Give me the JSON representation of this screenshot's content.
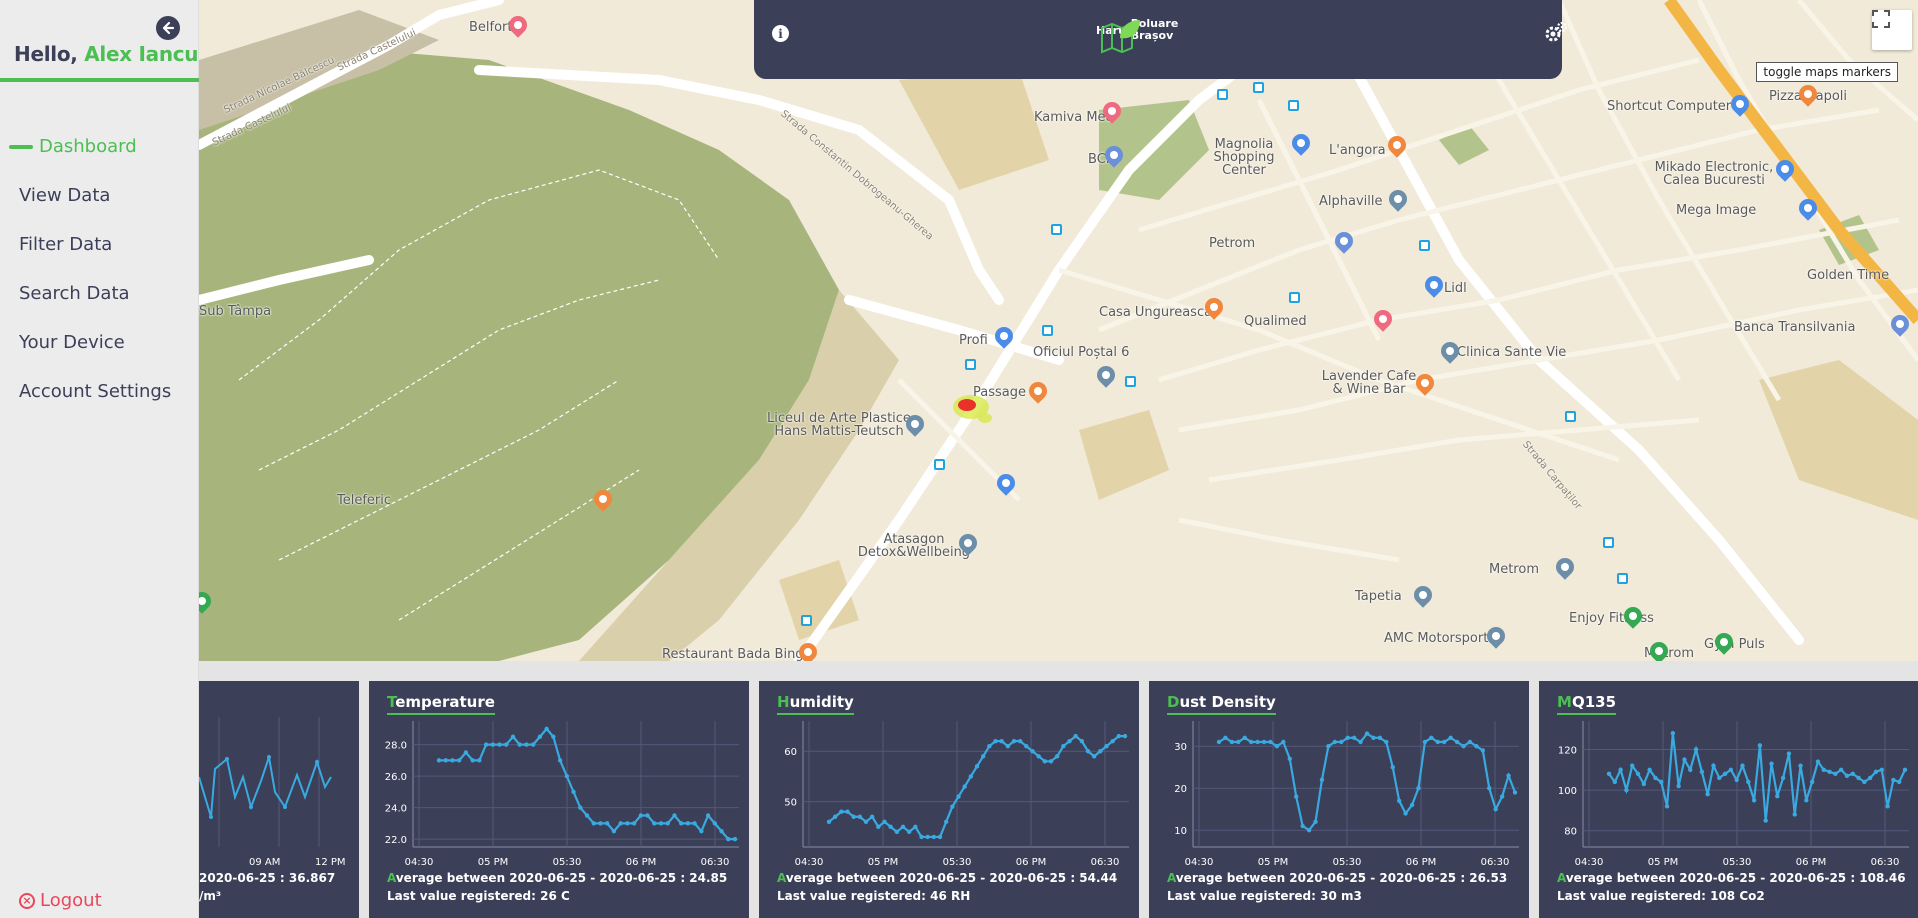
{
  "sidebar": {
    "greeting_prefix": "Hello, ",
    "user_name": "Alex Iancu",
    "items": [
      {
        "label": "Dashboard",
        "active": true
      },
      {
        "label": "View Data"
      },
      {
        "label": "Filter Data"
      },
      {
        "label": "Search Data"
      },
      {
        "label": "Your Device"
      },
      {
        "label": "Account Settings"
      }
    ],
    "logout_label": "Logout"
  },
  "topbar": {
    "logo_line1": "Harta",
    "logo_line2a": "Poluare",
    "logo_line2b": "Brașov"
  },
  "map": {
    "toggle_markers_label": "toggle maps markers",
    "labels": [
      "Belfort",
      "Strada Nicolae Bălcescu",
      "Strada Castelului",
      "Strada Castelului",
      "Strada Constantin Dobrogeanu-Gherea",
      "Kamiva Med",
      "BCR",
      "Magnolia Shopping Center",
      "L'angora",
      "Alphaville",
      "Petrom",
      "Lidl",
      "Casa Ungurească",
      "Qualimed",
      "Profi",
      "Oficiul Poștal 6",
      "Passage",
      "Lavender Cafe & Wine Bar",
      "Clinica Sante Vie",
      "Liceul de Arte Plastice Hans Mattis-Teutsch",
      "Atasagon Detox&Wellbeing",
      "Metrom",
      "Tapetia",
      "Enjoy Fitness",
      "AMC Motorsport",
      "Gym Puls",
      "Metrom",
      "Shortcut Computer",
      "Pizza Napoli",
      "Mikado Electronic, Calea Bucuresti",
      "Mega Image",
      "Golden Time",
      "Banca Transilvania",
      "Sub Tâmpa",
      "Teleferic",
      "Restaurant Bada Bing",
      "Strada Carpaților"
    ],
    "accent_color": "#4bbf52"
  },
  "cards": [
    {
      "title_first": "",
      "title_rest": "",
      "avg_first": "",
      "avg_rest": "2020-06-25 : 36.867",
      "last": "/m³",
      "x_ticks": [
        "09 AM",
        "12 PM"
      ]
    },
    {
      "title_first": "T",
      "title_rest": "emperature",
      "avg_first": "A",
      "avg_rest": "verage between 2020-06-25 - 2020-06-25 : 24.85",
      "last": "Last value registered: 26 C",
      "x_ticks": [
        "04:30",
        "05 PM",
        "05:30",
        "06 PM",
        "06:30"
      ],
      "y_ticks": [
        "28.0",
        "26.0",
        "24.0",
        "22.0"
      ]
    },
    {
      "title_first": "H",
      "title_rest": "umidity",
      "avg_first": "A",
      "avg_rest": "verage between 2020-06-25 - 2020-06-25 : 54.44",
      "last": "Last value registered: 46 RH",
      "x_ticks": [
        "04:30",
        "05 PM",
        "05:30",
        "06 PM",
        "06:30"
      ],
      "y_ticks": [
        "60",
        "50"
      ]
    },
    {
      "title_first": "D",
      "title_rest": "ust Density",
      "avg_first": "A",
      "avg_rest": "verage between 2020-06-25 - 2020-06-25 : 26.53",
      "last": "Last value registered: 30 m3",
      "x_ticks": [
        "04:30",
        "05 PM",
        "05:30",
        "06 PM",
        "06:30"
      ],
      "y_ticks": [
        "30",
        "20",
        "10"
      ]
    },
    {
      "title_first": "M",
      "title_rest": "Q135",
      "avg_first": "A",
      "avg_rest": "verage between 2020-06-25 - 2020-06-25 : 108.46",
      "last": "Last value registered: 108 Co2",
      "x_ticks": [
        "04:30",
        "05 PM",
        "05:30",
        "06 PM",
        "06:30"
      ],
      "y_ticks": [
        "120",
        "100",
        "80"
      ]
    }
  ],
  "chart_data": [
    {
      "type": "line",
      "title": "Temperature",
      "y_ticks": [
        28,
        26,
        24,
        22
      ],
      "ylim": [
        21.5,
        29.5
      ],
      "values": [
        27,
        27,
        27,
        27,
        27.5,
        27,
        27,
        28,
        28,
        28,
        28,
        28.5,
        28,
        28,
        28,
        28.5,
        29,
        28.5,
        27,
        26,
        25,
        24,
        23.5,
        23,
        23,
        23,
        22.5,
        23,
        23,
        23,
        23.5,
        23.5,
        23,
        23,
        23,
        23.5,
        23,
        23,
        23,
        22.5,
        23.5,
        23,
        22.5,
        22,
        22
      ]
    },
    {
      "type": "line",
      "title": "Humidity",
      "y_ticks": [
        60,
        50
      ],
      "ylim": [
        41,
        66
      ],
      "values": [
        46,
        47,
        48,
        48,
        47,
        47,
        46,
        47,
        45,
        46,
        45,
        44,
        45,
        44,
        45,
        43,
        43,
        43,
        43,
        46,
        49,
        51,
        53,
        55,
        57,
        59,
        61,
        62,
        62,
        61,
        62,
        62,
        61,
        60,
        59,
        58,
        58,
        59,
        61,
        62,
        63,
        62,
        60,
        59,
        60,
        61,
        62,
        63,
        63
      ]
    },
    {
      "type": "line",
      "title": "Dust Density",
      "y_ticks": [
        30,
        20,
        10
      ],
      "ylim": [
        6,
        36
      ],
      "values": [
        31,
        32,
        31,
        31,
        32,
        31,
        31,
        31,
        31,
        30,
        31,
        27,
        18,
        11,
        10,
        12,
        22,
        30,
        31,
        31,
        32,
        32,
        31,
        33,
        32,
        32,
        31,
        25,
        17,
        14,
        16,
        20,
        31,
        32,
        31,
        31,
        32,
        31,
        30,
        31,
        30,
        29,
        20,
        15,
        18,
        23,
        19
      ]
    },
    {
      "type": "line",
      "title": "MQ135",
      "y_ticks": [
        120,
        100,
        80
      ],
      "ylim": [
        72,
        134
      ],
      "values": [
        108,
        104,
        110,
        100,
        112,
        108,
        103,
        110,
        106,
        104,
        92,
        128,
        102,
        115,
        110,
        120,
        109,
        98,
        112,
        106,
        108,
        110,
        105,
        112,
        104,
        95,
        122,
        85,
        113,
        97,
        106,
        118,
        88,
        112,
        95,
        104,
        114,
        110,
        109,
        108,
        110,
        107,
        108,
        106,
        104,
        106,
        109,
        110,
        92,
        105,
        104,
        110
      ]
    }
  ]
}
